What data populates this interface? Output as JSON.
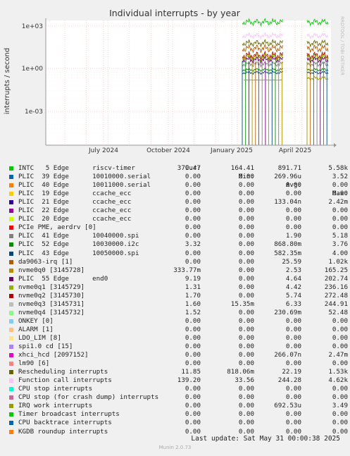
{
  "chart_data": {
    "type": "line",
    "title": "Individual interrupts - by year",
    "ylabel": "interrupts / second",
    "yscale": "log",
    "yticks": [
      "1e+03",
      "1e+00",
      "1e-03"
    ],
    "xticks": [
      "July 2024",
      "October 2024",
      "January 2025",
      "April 2025"
    ],
    "watermark": "RRDTOOL / TOBI OETIKER",
    "legend_headers": [
      "Cur:",
      "Min:",
      "Avg:",
      "Max:"
    ],
    "series": [
      {
        "name": "INTC   5 Edge      riscv-timer",
        "color": "#00cc00",
        "cur": "379.47",
        "min": "164.41",
        "avg": "891.71",
        "max": "5.58k"
      },
      {
        "name": "PLIC  39 Edge      10010000.serial",
        "color": "#0066b3",
        "cur": "0.00",
        "min": "0.00",
        "avg": "269.96u",
        "max": "3.52"
      },
      {
        "name": "PLIC  40 Edge      10011000.serial",
        "color": "#ff8000",
        "cur": "0.00",
        "min": "0.00",
        "avg": "0.00",
        "max": "0.00"
      },
      {
        "name": "PLIC  19 Edge      ccache_ecc",
        "color": "#ffcc00",
        "cur": "0.00",
        "min": "0.00",
        "avg": "0.00",
        "max": "0.00"
      },
      {
        "name": "PLIC  21 Edge      ccache_ecc",
        "color": "#330099",
        "cur": "0.00",
        "min": "0.00",
        "avg": "133.04n",
        "max": "2.42m"
      },
      {
        "name": "PLIC  22 Edge      ccache_ecc",
        "color": "#990099",
        "cur": "0.00",
        "min": "0.00",
        "avg": "0.00",
        "max": "0.00"
      },
      {
        "name": "PLIC  20 Edge      ccache_ecc",
        "color": "#ccff00",
        "cur": "0.00",
        "min": "0.00",
        "avg": "0.00",
        "max": "0.00"
      },
      {
        "name": "PCIe PME, aerdrv [0]",
        "color": "#ff0000",
        "cur": "0.00",
        "min": "0.00",
        "avg": "0.00",
        "max": "0.00"
      },
      {
        "name": "PLIC  41 Edge      10040000.spi",
        "color": "#808080",
        "cur": "0.00",
        "min": "0.00",
        "avg": "1.90",
        "max": "5.18"
      },
      {
        "name": "PLIC  52 Edge      10030000.i2c",
        "color": "#008f00",
        "cur": "3.32",
        "min": "0.00",
        "avg": "868.80m",
        "max": "3.76"
      },
      {
        "name": "PLIC  43 Edge      10050000.spi",
        "color": "#00487d",
        "cur": "0.00",
        "min": "0.00",
        "avg": "582.35m",
        "max": "4.00"
      },
      {
        "name": "da9063-irq [1]",
        "color": "#b35a00",
        "cur": "0.00",
        "min": "0.00",
        "avg": "25.59",
        "max": "1.02k"
      },
      {
        "name": "nvme0q0 [3145728]",
        "color": "#b38f00",
        "cur": "333.77m",
        "min": "0.00",
        "avg": "2.53",
        "max": "165.25"
      },
      {
        "name": "PLIC  55 Edge      end0",
        "color": "#6b006b",
        "cur": "9.19",
        "min": "0.00",
        "avg": "4.64",
        "max": "202.74"
      },
      {
        "name": "nvme0q1 [3145729]",
        "color": "#8fb300",
        "cur": "1.31",
        "min": "0.00",
        "avg": "4.42",
        "max": "236.16"
      },
      {
        "name": "nvme0q2 [3145730]",
        "color": "#b30000",
        "cur": "1.70",
        "min": "0.00",
        "avg": "5.74",
        "max": "272.48"
      },
      {
        "name": "nvme0q3 [3145731]",
        "color": "#bebebe",
        "cur": "1.60",
        "min": "15.35m",
        "avg": "6.33",
        "max": "244.91"
      },
      {
        "name": "nvme0q4 [3145732]",
        "color": "#80ff80",
        "cur": "1.52",
        "min": "0.00",
        "avg": "230.69m",
        "max": "52.48"
      },
      {
        "name": "ONKEY [0]",
        "color": "#80c9ff",
        "cur": "0.00",
        "min": "0.00",
        "avg": "0.00",
        "max": "0.00"
      },
      {
        "name": "ALARM [1]",
        "color": "#ffc080",
        "cur": "0.00",
        "min": "0.00",
        "avg": "0.00",
        "max": "0.00"
      },
      {
        "name": "LDO_LIM [8]",
        "color": "#ffe680",
        "cur": "0.00",
        "min": "0.00",
        "avg": "0.00",
        "max": "0.00"
      },
      {
        "name": "spi1.0 cd [15]",
        "color": "#aa80ff",
        "cur": "0.00",
        "min": "0.00",
        "avg": "0.00",
        "max": "0.00"
      },
      {
        "name": "xhci_hcd [2097152]",
        "color": "#ee00cc",
        "cur": "0.00",
        "min": "0.00",
        "avg": "266.07n",
        "max": "2.47m"
      },
      {
        "name": "lm90 [6]",
        "color": "#ff8080",
        "cur": "0.00",
        "min": "0.00",
        "avg": "0.00",
        "max": "0.00"
      },
      {
        "name": "Rescheduling interrupts",
        "color": "#666600",
        "cur": "11.85",
        "min": "818.06m",
        "avg": "22.19",
        "max": "1.53k"
      },
      {
        "name": "Function call interrupts",
        "color": "#ffbfff",
        "cur": "139.20",
        "min": "33.56",
        "avg": "244.28",
        "max": "4.62k"
      },
      {
        "name": "CPU stop interrupts",
        "color": "#00ffcc",
        "cur": "0.00",
        "min": "0.00",
        "avg": "0.00",
        "max": "0.00"
      },
      {
        "name": "CPU stop (for crash dump) interrupts",
        "color": "#cc6699",
        "cur": "0.00",
        "min": "0.00",
        "avg": "0.00",
        "max": "0.00"
      },
      {
        "name": "IRQ work interrupts",
        "color": "#999900",
        "cur": "0.00",
        "min": "0.00",
        "avg": "692.53u",
        "max": "3.49"
      },
      {
        "name": "Timer broadcast interrupts",
        "color": "#00cc00",
        "cur": "0.00",
        "min": "0.00",
        "avg": "0.00",
        "max": "0.00"
      },
      {
        "name": "CPU backtrace interrupts",
        "color": "#0066b3",
        "cur": "0.00",
        "min": "0.00",
        "avg": "0.00",
        "max": "0.00"
      },
      {
        "name": "KGDB roundup interrupts",
        "color": "#ff8000",
        "cur": "0.00",
        "min": "0.00",
        "avg": "0.00",
        "max": "0.00"
      }
    ]
  },
  "footer": {
    "last_update": "Last update: Sat May 31 00:00:38 2025",
    "munin": "Munin 2.0.73"
  }
}
